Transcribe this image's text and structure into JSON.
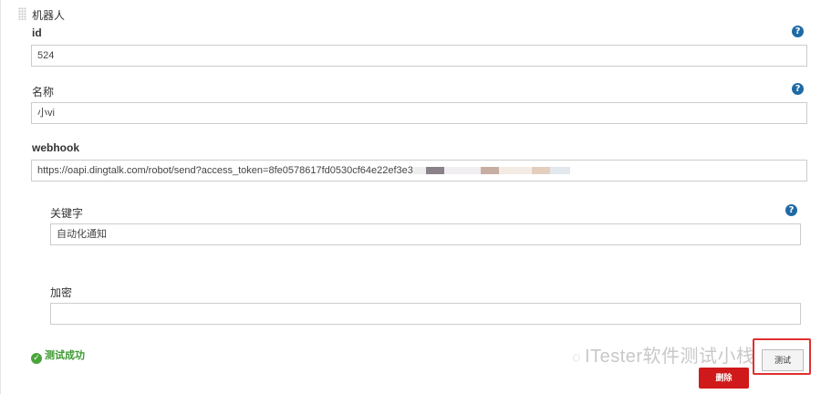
{
  "section": {
    "title": "机器人"
  },
  "fields": {
    "id": {
      "label": "id",
      "value": "524"
    },
    "name": {
      "label": "名称",
      "value": "小vi"
    },
    "webhook": {
      "label": "webhook",
      "value": "https://oapi.dingtalk.com/robot/send?access_token=8fe0578617fd0530cf64e22ef3e3"
    },
    "keyword": {
      "label": "关键字",
      "value": "自动化通知"
    },
    "secret": {
      "label": "加密",
      "value": ""
    }
  },
  "help_glyph": "?",
  "status": {
    "text": "测试成功",
    "icon": "check-circle-icon",
    "color": "#4aa43a"
  },
  "watermark": {
    "text": "ITester软件测试小栈"
  },
  "buttons": {
    "test_label": "测试",
    "delete_label": "删除"
  },
  "colors": {
    "help": "#1f6aa5",
    "delete": "#d0191a",
    "highlight": "#e03030"
  }
}
